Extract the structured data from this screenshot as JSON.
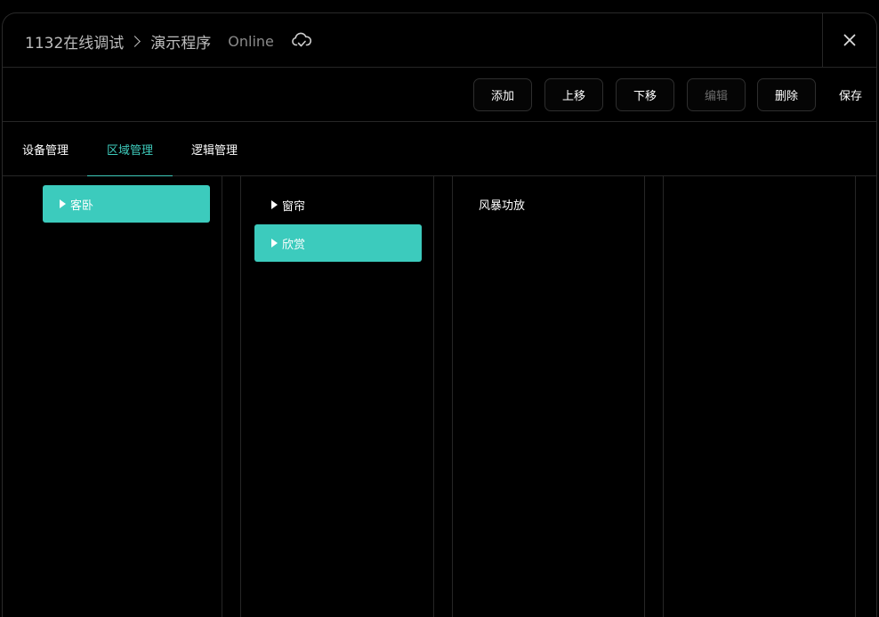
{
  "header": {
    "project": "1132在线调试",
    "program": "演示程序",
    "status": "Online",
    "status_icon": "cloud-sync-icon",
    "close_icon": "close-icon"
  },
  "toolbar": {
    "add_label": "添加",
    "move_up_label": "上移",
    "move_down_label": "下移",
    "edit_label": "编辑",
    "delete_label": "删除",
    "save_label": "保存"
  },
  "tabs": [
    {
      "label": "设备管理",
      "active": false
    },
    {
      "label": "区域管理",
      "active": true
    },
    {
      "label": "逻辑管理",
      "active": false
    }
  ],
  "columns": {
    "col1": [
      {
        "label": "客卧",
        "expandable": true,
        "selected": true
      }
    ],
    "col2": [
      {
        "label": "窗帘",
        "expandable": true,
        "selected": false
      },
      {
        "label": "欣赏",
        "expandable": true,
        "selected": true
      }
    ],
    "col3": [
      {
        "label": "风暴功放",
        "expandable": false,
        "selected": false
      }
    ]
  },
  "colors": {
    "accent": "#3ecbbc",
    "background": "#000000",
    "border": "#262626"
  }
}
